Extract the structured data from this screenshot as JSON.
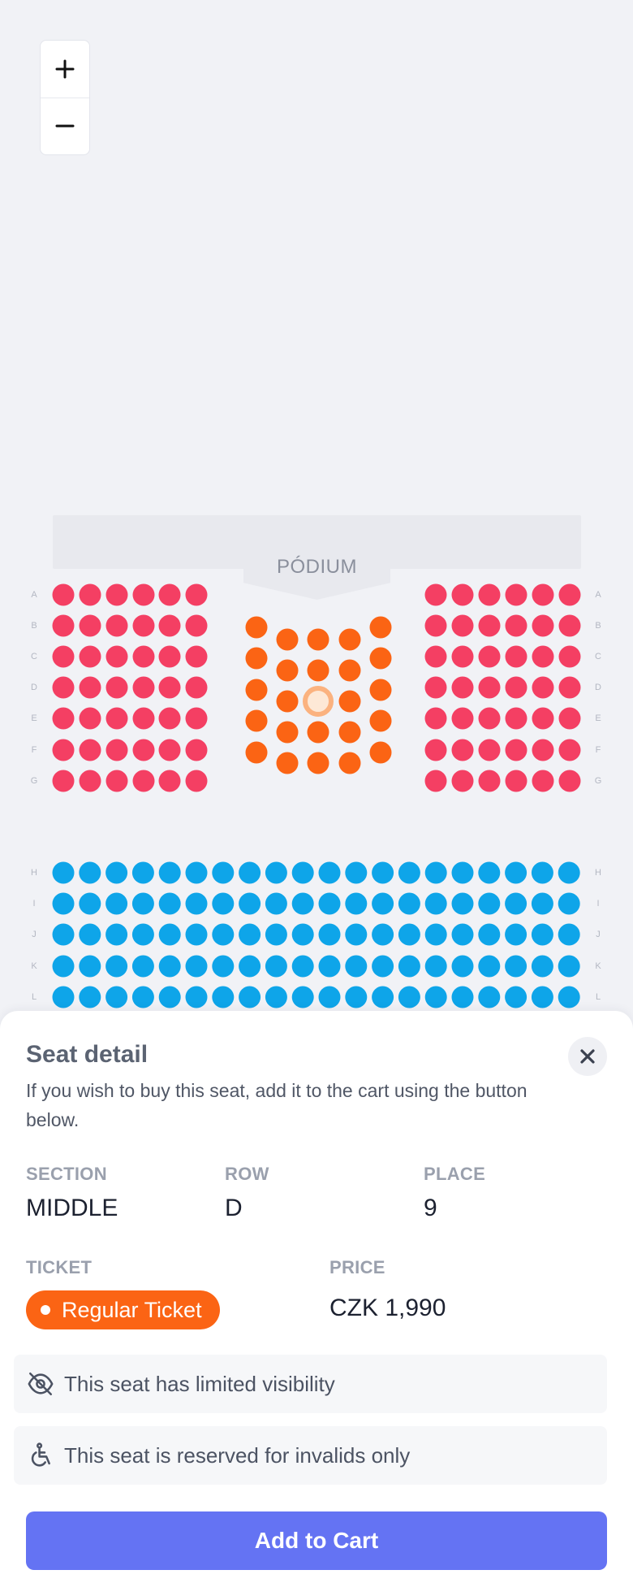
{
  "zoom": {
    "in_label": "+",
    "out_label": "−"
  },
  "map": {
    "stage_label": "PÓDIUM",
    "row_labels_top": [
      "A",
      "B",
      "C",
      "D",
      "E",
      "F",
      "G"
    ],
    "row_labels_bottom": [
      "H",
      "I",
      "J",
      "K",
      "L"
    ],
    "colors": {
      "side_sections": "#f43f63",
      "middle_section": "#fb6414",
      "rear_section": "#0ea5e9",
      "selected_seat": "#fde8d6"
    },
    "selected_seat": {
      "section": "MIDDLE",
      "row": "D",
      "place": "9"
    }
  },
  "seat_detail": {
    "title": "Seat detail",
    "description": "If you wish to buy this seat, add it to the cart using the button below.",
    "section_label": "SECTION",
    "section_value": "MIDDLE",
    "row_label": "ROW",
    "row_value": "D",
    "place_label": "PLACE",
    "place_value": "9",
    "ticket_label": "TICKET",
    "ticket_value": "Regular Ticket",
    "price_label": "PRICE",
    "price_value": "CZK 1,990",
    "notices": [
      {
        "icon": "eye-off-icon",
        "text": "This seat has limited visibility"
      },
      {
        "icon": "wheelchair-icon",
        "text": "This seat is reserved for invalids only"
      }
    ],
    "add_button": "Add to Cart",
    "close_icon": "close-icon"
  }
}
